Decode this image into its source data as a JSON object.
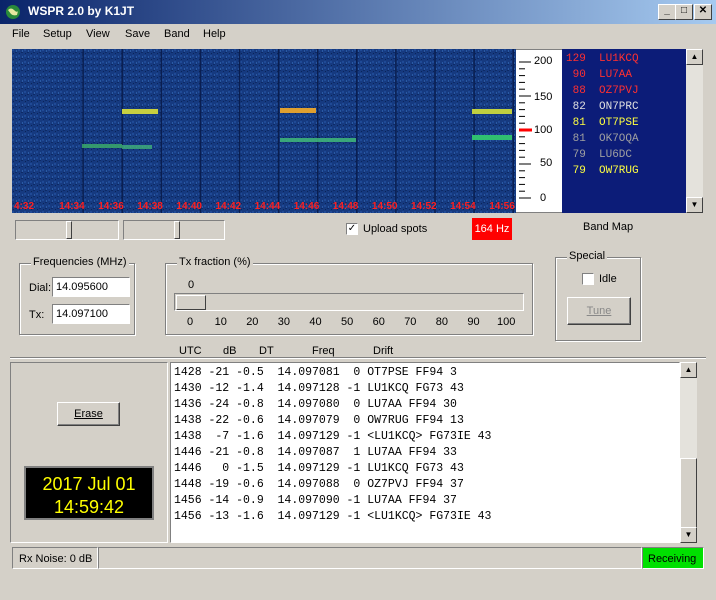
{
  "window": {
    "title": "WSPR 2.0    by K1JT",
    "min": "_",
    "max": "□",
    "close": "✕"
  },
  "menu": [
    "File",
    "Setup",
    "View",
    "Save",
    "Band",
    "Help"
  ],
  "waterfall": {
    "time_labels": [
      "4:32",
      "14:34",
      "14:36",
      "14:38",
      "14:40",
      "14:42",
      "14:44",
      "14:46",
      "14:48",
      "14:50",
      "14:52",
      "14:54",
      "14:56"
    ],
    "label_color": "#ff2020"
  },
  "scale": {
    "ticks": [
      "200",
      "150",
      "100",
      "50",
      "0"
    ],
    "marker_color": "#ff0000"
  },
  "band_map": {
    "label": "Band Map",
    "entries": [
      {
        "text": "129  LU1KCQ",
        "color": "#ff3030"
      },
      {
        "text": " 90  LU7AA",
        "color": "#ff3030"
      },
      {
        "text": " 88  OZ7PVJ",
        "color": "#ff3030"
      },
      {
        "text": " 82  ON7PRC",
        "color": "#e0e0e0"
      },
      {
        "text": " 81  OT7PSE",
        "color": "#ffff40"
      },
      {
        "text": " 81  OK7OQA",
        "color": "#a0a0a0"
      },
      {
        "text": " 79  LU6DC",
        "color": "#a0a0a0"
      },
      {
        "text": " 79  OW7RUG",
        "color": "#ffff40"
      }
    ]
  },
  "controls": {
    "upload_label": "Upload spots",
    "freq_badge": "164 Hz",
    "freq_badge_color": "#ff0000"
  },
  "frequencies": {
    "legend": "Frequencies (MHz)",
    "dial_label": "Dial:",
    "dial_value": "14.095600",
    "tx_label": "Tx:",
    "tx_value": "14.097100"
  },
  "tx_fraction": {
    "legend": "Tx fraction (%)",
    "value_display": "0",
    "value": 0,
    "ticks": [
      "0",
      "10",
      "20",
      "30",
      "40",
      "50",
      "60",
      "70",
      "80",
      "90",
      "100"
    ]
  },
  "special": {
    "legend": "Special",
    "idle_label": "Idle",
    "tune_label": "Tune"
  },
  "decode_headers": {
    "utc": "UTC",
    "db": "dB",
    "dt": "DT",
    "freq": "Freq",
    "drift": "Drift"
  },
  "decodes": [
    "1428 -21 -0.5  14.097081  0 OT7PSE FF94 3",
    "1430 -12 -1.4  14.097128 -1 LU1KCQ FG73 43",
    "1436 -24 -0.8  14.097080  0 LU7AA FF94 30",
    "1438 -22 -0.6  14.097079  0 OW7RUG FF94 13",
    "1438  -7 -1.6  14.097129 -1 <LU1KCQ> FG73IE 43",
    "1446 -21 -0.8  14.097087  1 LU7AA FF94 33",
    "1446   0 -1.5  14.097129 -1 LU1KCQ FG73 43",
    "1448 -19 -0.6  14.097088  0 OZ7PVJ FF94 37",
    "1456 -14 -0.9  14.097090 -1 LU7AA FF94 37",
    "1456 -13 -1.6  14.097129 -1 <LU1KCQ> FG73IE 43"
  ],
  "erase_label": "Erase",
  "clock": {
    "date": "2017 Jul 01",
    "time": "14:59:42"
  },
  "status": {
    "rx_noise": "Rx Noise: 0 dB",
    "state": "Receiving",
    "state_color": "#00e000"
  }
}
